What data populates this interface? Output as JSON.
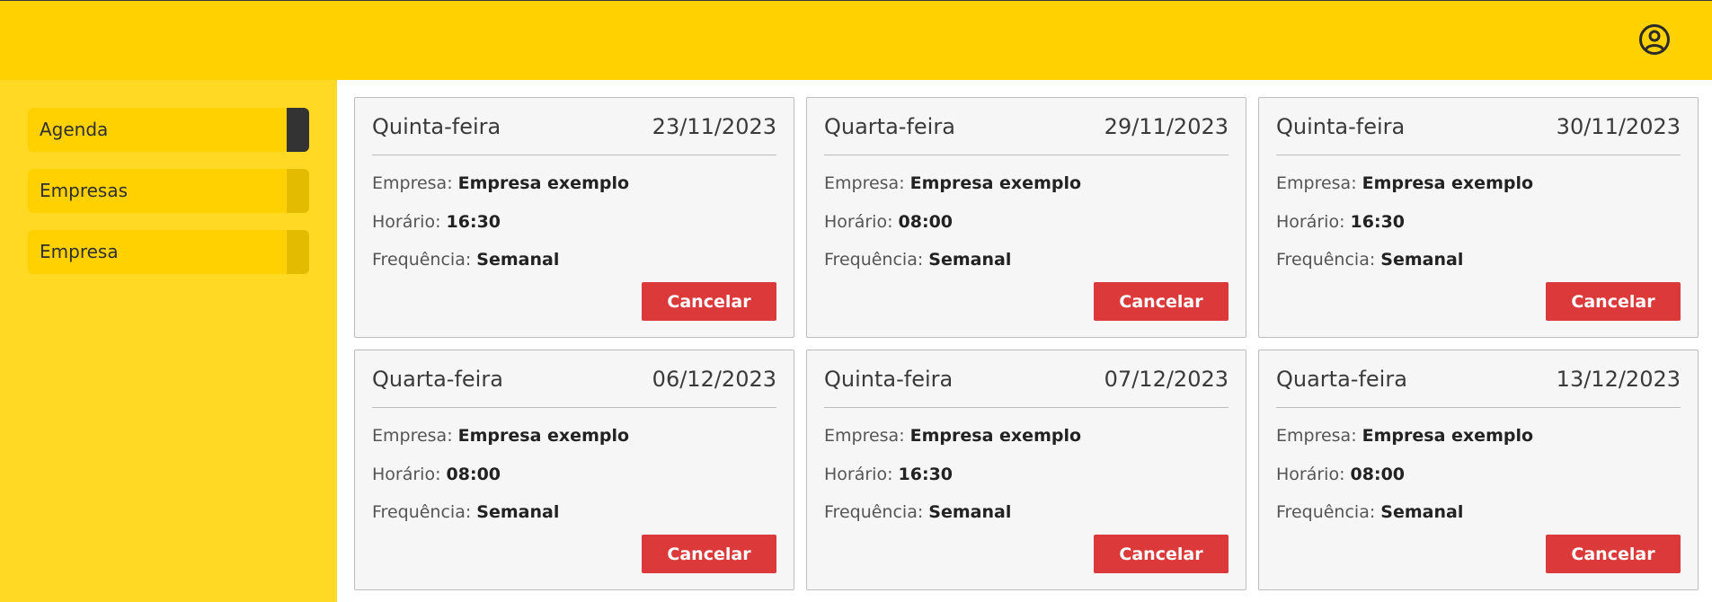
{
  "header": {
    "user_icon": "user-circle-icon"
  },
  "sidebar": {
    "items": [
      {
        "label": "Agenda",
        "active": true
      },
      {
        "label": "Empresas",
        "active": false
      },
      {
        "label": "Empresa",
        "active": false
      }
    ]
  },
  "labels": {
    "company": "Empresa:",
    "time": "Horário:",
    "frequency": "Frequência:",
    "cancel": "Cancelar"
  },
  "appointments": [
    {
      "day": "Quinta-feira",
      "date": "23/11/2023",
      "company": "Empresa exemplo",
      "time": "16:30",
      "frequency": "Semanal"
    },
    {
      "day": "Quarta-feira",
      "date": "29/11/2023",
      "company": "Empresa exemplo",
      "time": "08:00",
      "frequency": "Semanal"
    },
    {
      "day": "Quinta-feira",
      "date": "30/11/2023",
      "company": "Empresa exemplo",
      "time": "16:30",
      "frequency": "Semanal"
    },
    {
      "day": "Quarta-feira",
      "date": "06/12/2023",
      "company": "Empresa exemplo",
      "time": "08:00",
      "frequency": "Semanal"
    },
    {
      "day": "Quinta-feira",
      "date": "07/12/2023",
      "company": "Empresa exemplo",
      "time": "16:30",
      "frequency": "Semanal"
    },
    {
      "day": "Quarta-feira",
      "date": "13/12/2023",
      "company": "Empresa exemplo",
      "time": "08:00",
      "frequency": "Semanal"
    }
  ],
  "colors": {
    "topbar": "#ffd100",
    "sidebar": "#ffd923",
    "cancel_button": "#dc3a3a",
    "active_tab": "#333333"
  }
}
